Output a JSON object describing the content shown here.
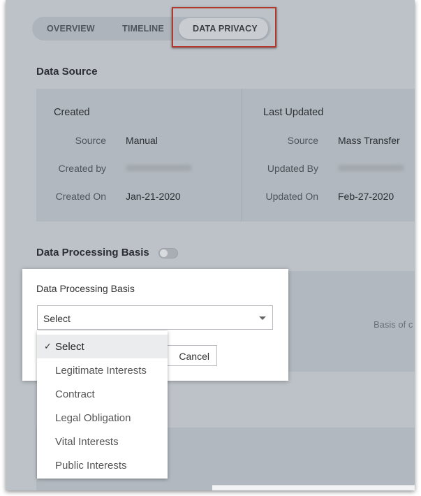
{
  "tabs": [
    {
      "label": "OVERVIEW"
    },
    {
      "label": "TIMELINE"
    },
    {
      "label": "DATA PRIVACY",
      "active": true
    }
  ],
  "data_source": {
    "title": "Data Source",
    "created": {
      "heading": "Created",
      "rows": [
        {
          "label": "Source",
          "value": "Manual"
        },
        {
          "label": "Created by",
          "value": ""
        },
        {
          "label": "Created On",
          "value": "Jan-21-2020"
        }
      ]
    },
    "last_updated": {
      "heading": "Last Updated",
      "rows": [
        {
          "label": "Source",
          "value": "Mass Transfer"
        },
        {
          "label": "Updated By",
          "value": ""
        },
        {
          "label": "Updated On",
          "value": "Feb-27-2020"
        }
      ]
    }
  },
  "processing": {
    "title": "Data Processing Basis",
    "toggle_on": false,
    "background_text": "Basis of c"
  },
  "popup": {
    "title": "Data Processing Basis",
    "select_value": "Select",
    "cancel_label": "Cancel"
  },
  "dropdown": {
    "check_glyph": "✓",
    "options": [
      {
        "label": "Select",
        "selected": true
      },
      {
        "label": "Legitimate Interests"
      },
      {
        "label": "Contract"
      },
      {
        "label": "Legal Obligation"
      },
      {
        "label": "Vital Interests"
      },
      {
        "label": "Public Interests"
      }
    ]
  },
  "colors": {
    "highlight": "#b03a2e",
    "overlay_bg": "#bdc2c8"
  }
}
